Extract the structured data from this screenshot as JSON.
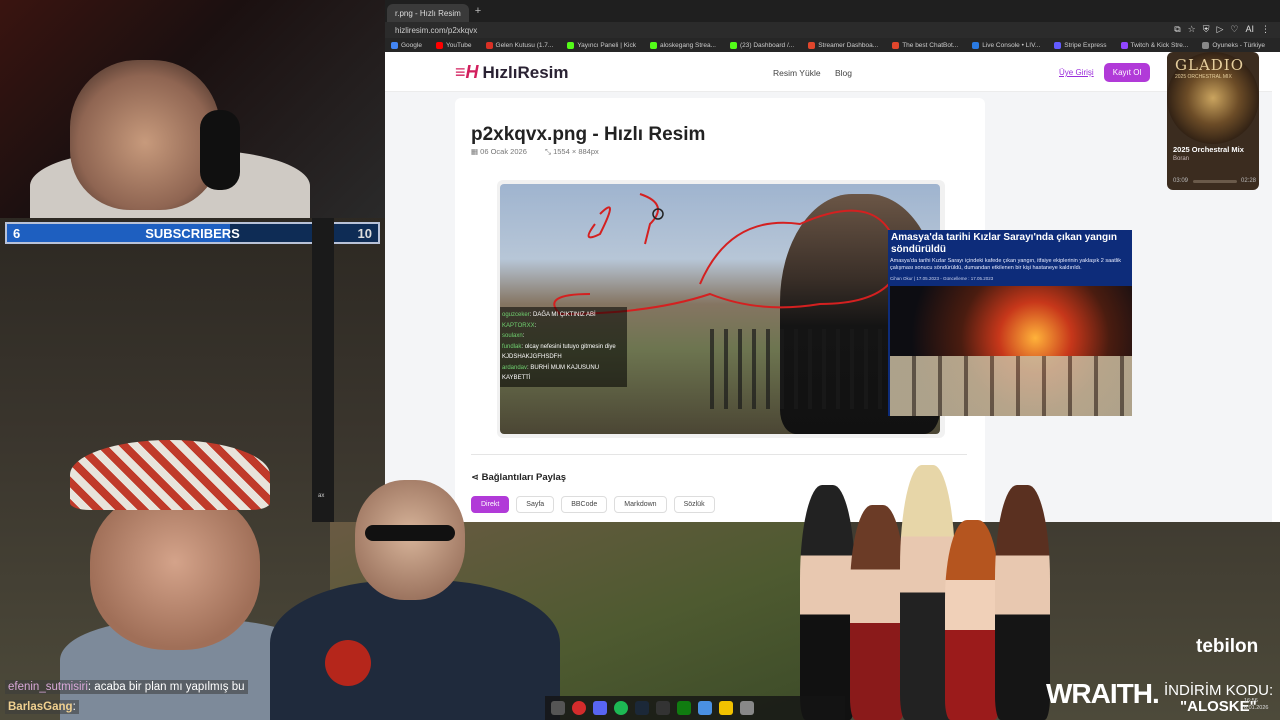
{
  "browser": {
    "tab_title": "r.png - Hızlı Resim",
    "new_tab": "+",
    "url": "hizliresim.com/p2xkqvx",
    "bookmarks": [
      {
        "label": "Google",
        "color": "#4285f4"
      },
      {
        "label": "YouTube",
        "color": "#ff0000"
      },
      {
        "label": "Gelen Kutusu (1.7...",
        "color": "#d93025"
      },
      {
        "label": "Yayıncı Paneli | Kick",
        "color": "#53fc18"
      },
      {
        "label": "aloskegang Strea...",
        "color": "#53fc18"
      },
      {
        "label": "(23) Dashboard /...",
        "color": "#53fc18"
      },
      {
        "label": "Streamer Dashboa...",
        "color": "#e0462c"
      },
      {
        "label": "The best ChatBot...",
        "color": "#e0462c"
      },
      {
        "label": "Live Console • LIV...",
        "color": "#2a7ae2"
      },
      {
        "label": "Stripe Express",
        "color": "#635bff"
      },
      {
        "label": "Twitch & Kick Stre...",
        "color": "#9146ff"
      },
      {
        "label": "Oyuneks - Türkiye",
        "color": "#888888"
      }
    ],
    "ext_ai": "AI"
  },
  "site": {
    "brand": "HızlıResim",
    "nav": [
      "Resim Yükle",
      "Blog"
    ],
    "login": "Üye Girişi",
    "signup": "Kayıt Ol",
    "title": "p2xkqvx.png - Hızlı Resim",
    "date": "06 Ocak 2026",
    "dimensions": "1554 × 884px",
    "share_heading": "Bağlantıları Paylaş",
    "share_buttons": [
      "Direkt",
      "Sayfa",
      "BBCode",
      "Markdown",
      "Sözlük"
    ]
  },
  "image_chat": [
    {
      "user": "oguzceker",
      "msg": ": DAĞA MI ÇIKTINIZ ABİ"
    },
    {
      "user": "KAPTORXX",
      "msg": ":"
    },
    {
      "user": "soulaxn",
      "msg": ":"
    },
    {
      "user": "fundlak",
      "msg": ": olcay nefesini tutuyo gitmesin diye KJDSHAKJGFHSDFH"
    },
    {
      "user": "ardandav",
      "msg": ": BURHİ MUM KAJUSUNU KAYBETTİ"
    }
  ],
  "news": {
    "headline": "Amasya'da tarihi Kızlar Sarayı'nda çıkan yangın söndürüldü",
    "body": "Amasya'da tarihi Kızlar Sarayı içindeki kafede çıkan yangın, itfaiye ekiplerinin yaklaşık 2 saatlik çalışması sonucu söndürüldü, dumandan etkilenen bir kişi hastaneye kaldırıldı.",
    "meta": "Cihan Okur  |  17.05.2023 - Güncelleme : 17.05.2023"
  },
  "stream": {
    "sub_count": "6",
    "sub_label": "SUBSCRIBERS",
    "sub_goal": "10",
    "sub_progress": 0.6,
    "chat": [
      {
        "user": "efenin_sutmisiri",
        "msg": ": acaba bir plan mı yapılmış bu"
      },
      {
        "user": "BarlasGang",
        "msg": ":"
      }
    ],
    "side_text": "ax",
    "sponsor1": "tebilon",
    "sponsor2": "WRAITH.",
    "discount_label": "İNDİRİM KODU:",
    "discount_code": "\"ALOSKE\"",
    "clock_time": "16:56",
    "clock_date": "6.01.2026"
  },
  "music": {
    "brand": "GLADIO",
    "sub": "2025 ORCHESTRAL MIX",
    "title": "2025 Orchestral Mix",
    "artist": "Boran",
    "elapsed": "03:09",
    "total": "02:28"
  },
  "colors": {
    "accent": "#b13ad8",
    "brand_red": "#d21f5d",
    "news_blue": "#0d2c7a",
    "sub_bar": "#1e5fc0"
  }
}
